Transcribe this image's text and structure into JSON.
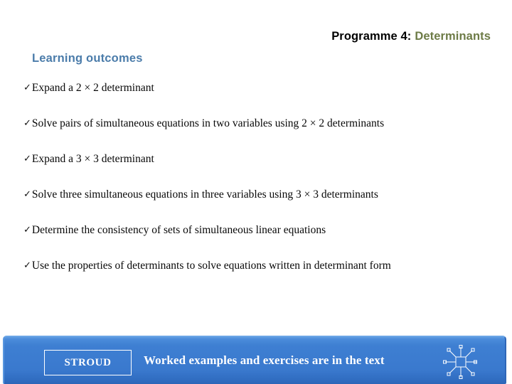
{
  "slide": {
    "title": {
      "programme": "Programme 4:",
      "topic": "Determinants"
    },
    "section_heading": "Learning outcomes",
    "bullet_icon": "check-icon",
    "outcomes": [
      {
        "text": "Expand a 2 × 2 determinant"
      },
      {
        "text": "Solve pairs of simultaneous equations in two variables using 2 × 2 determinants"
      },
      {
        "text": "Expand a 3 × 3 determinant"
      },
      {
        "text": "Solve three simultaneous equations in three variables using 3 × 3 determinants"
      },
      {
        "text": "Determine the consistency of sets of simultaneous linear equations"
      },
      {
        "text": "Use the properties of determinants to solve equations written in determinant form"
      }
    ],
    "footer": {
      "logo_label": "STROUD",
      "message": "Worked examples and exercises are in the text",
      "decoration_icon": "starburst-icon"
    },
    "colors": {
      "title_programme": "#000000",
      "title_topic": "#6d7b46",
      "section_heading": "#4b7caa",
      "body_text": "#080808",
      "footer_bar": "#3a79ce",
      "footer_text": "#ffffff",
      "page_background": "#ffffff"
    }
  }
}
